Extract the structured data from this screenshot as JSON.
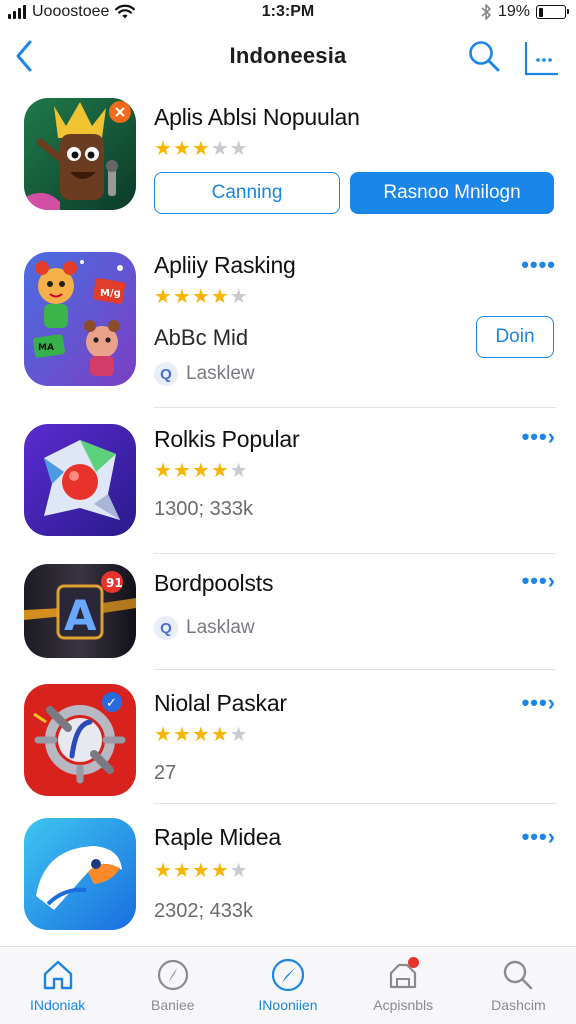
{
  "status_bar": {
    "carrier": "Uooostoee",
    "time": "1:3:PM",
    "battery": "19%",
    "battery_level": 0.19
  },
  "nav": {
    "title": "Indoneesia"
  },
  "apps": [
    {
      "name": "Aplis Ablsi Nopuulan",
      "rating": 3,
      "buttons": {
        "secondary": "Canning",
        "primary": "Rasnoo Mnilogn"
      }
    },
    {
      "name": "Apliiy Rasking",
      "rating": 3.5,
      "meta": "AbBc Mid",
      "tag": "Lasklew",
      "tag_icon": "Q",
      "action": "Doin",
      "more": "••••"
    },
    {
      "name": "Rolkis Popular",
      "rating": 4,
      "meta": "1300; 333k",
      "more": "•••›"
    },
    {
      "name": "Bordpoolsts",
      "tag": "Lasklaw",
      "tag_icon": "Q",
      "more": "•••›"
    },
    {
      "name": "Niolal Paskar",
      "rating": 4,
      "meta": "27",
      "more": "•••›"
    },
    {
      "name": "Raple Midea",
      "rating": 4,
      "meta": "2302; 433k",
      "more": "•••›"
    }
  ],
  "tabs": [
    {
      "label": "INdoniak",
      "icon": "home-icon",
      "active": true
    },
    {
      "label": "Baniee",
      "icon": "compass-icon",
      "active": false
    },
    {
      "label": "INooniien",
      "icon": "navigation-icon",
      "active": true
    },
    {
      "label": "Acpisnbls",
      "icon": "apps-icon",
      "active": false,
      "badge": true
    },
    {
      "label": "Dashcim",
      "icon": "search-icon",
      "active": false
    }
  ],
  "colors": {
    "accent": "#1a86e8",
    "star": "#f7b500",
    "star_empty": "#c9c9ce",
    "badge": "#e8322c"
  }
}
